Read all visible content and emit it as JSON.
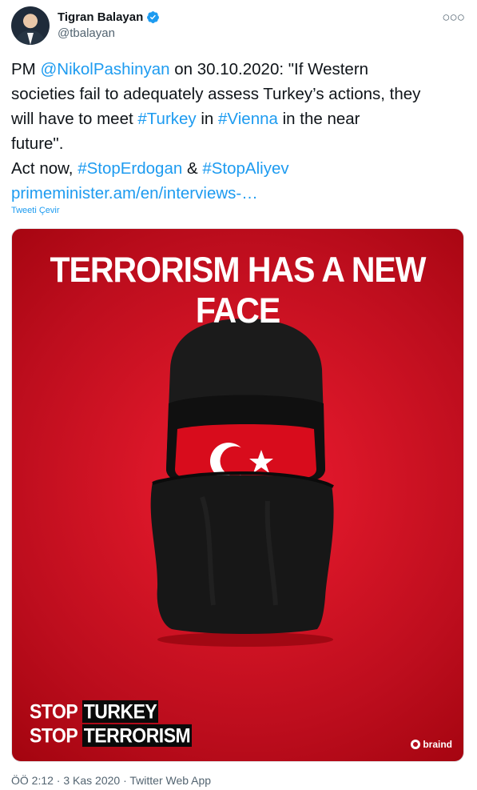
{
  "author": {
    "display_name": "Tigran Balayan",
    "handle": "@tbalayan",
    "verified_icon": "verified-badge-icon",
    "more_icon": "more-options-icon"
  },
  "tweet": {
    "line1": {
      "prefix": "PM ",
      "mention": "@NikolPashinyan",
      "suffix": " on 30.10.2020: \"If Western"
    },
    "line2": "societies fail to adequately assess Turkey’s actions, they",
    "line3": {
      "prefix": "will have to meet ",
      "tag1": "#Turkey",
      "mid": " in ",
      "tag2": "#Vienna",
      "suffix": " in the near"
    },
    "line4": "future\".",
    "line5": {
      "prefix": "Act now, ",
      "tag1": "#StopErdogan",
      "mid": " & ",
      "tag2": "#StopAliyev"
    },
    "link": "primeminister.am/en/interviews-…",
    "translate_label": "Tweeti Çevir"
  },
  "media": {
    "headline": "TERRORISM HAS A NEW FACE",
    "stop_line1": {
      "word": "STOP",
      "accent": "TURKEY"
    },
    "stop_line2": {
      "word": "STOP",
      "accent": "TERRORISM"
    },
    "brand": "braind",
    "colors": {
      "background": "#c8121f",
      "mask": "#161616",
      "flag": "#d80c1c"
    }
  },
  "meta": {
    "timestamp": "ÖÖ 2:12 · 3 Kas 2020 · Twitter Web App"
  },
  "colors": {
    "link": "#1d9bf0",
    "secondary": "#536471"
  }
}
